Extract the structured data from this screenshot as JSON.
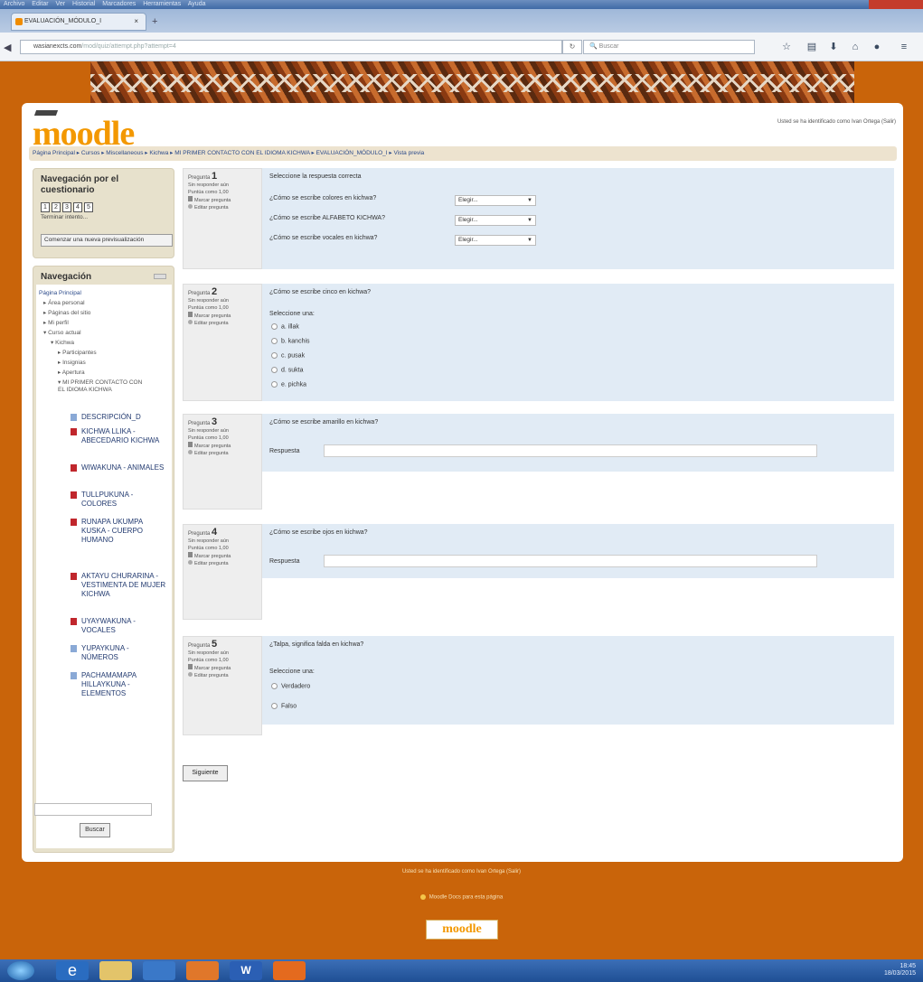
{
  "browser": {
    "menu": [
      "Archivo",
      "Editar",
      "Ver",
      "Historial",
      "Marcadores",
      "Herramientas",
      "Ayuda"
    ],
    "tab_title": "EVALUACIÓN_MÓDULO_I",
    "url_host": "wasianexcts.com",
    "url_path": "/mod/quiz/attempt.php?attempt=4",
    "search_placeholder": "Buscar"
  },
  "header": {
    "logo": "moodle",
    "logged_in": "Usted se ha identificado como Ivan Ortega (Salir)",
    "breadcrumb": "Página Principal ▸ Cursos ▸ Miscellaneous ▸ Kichwa ▸ MI PRIMER CONTACTO CON EL IDIOMA KICHWA ▸ EVALUACIÓN_MÓDULO_I ▸ Vista previa"
  },
  "quiz_nav": {
    "title": "Navegación por el cuestionario",
    "numbers": [
      "1",
      "2",
      "3",
      "4",
      "5"
    ],
    "finish": "Terminar intento...",
    "new_preview": "Comenzar una nueva previsualización"
  },
  "nav": {
    "title": "Navegación",
    "items": [
      "Página Principal",
      "Área personal",
      "Páginas del sitio",
      "Mi perfil",
      "Curso actual",
      "Kichwa",
      "Participantes",
      "Insignias",
      "Apertura",
      "MI PRIMER CONTACTO CON EL IDIOMA KICHWA"
    ],
    "resources": [
      "DESCRIPCIÓN_D",
      "KICHWA LLIKA - ABECEDARIO KICHWA",
      "WIWAKUNA - ANIMALES",
      "TULLPUKUNA - COLORES",
      "RUNAPA UKUMPA KUSKA - CUERPO HUMANO",
      "AKTAYU CHURARINA - VESTIMENTA DE MUJER KICHWA",
      "UYAYWAKUNA - VOCALES",
      "YUPAYKUNA - NÚMEROS",
      "PACHAMAMAPA HILLAYKUNA - ELEMENTOS"
    ],
    "search_button": "Buscar"
  },
  "question_meta": {
    "label": "Pregunta",
    "status": "Sin responder aún",
    "score": "Puntúa como 1,00",
    "flag": "Marcar pregunta",
    "edit": "Editar pregunta"
  },
  "q1": {
    "number": "1",
    "prompt": "Seleccione la respuesta correcta",
    "rows": [
      "¿Cómo se escribe colores en kichwa?",
      "¿Cómo se escribe ALFABETO KICHWA?",
      "¿Cómo se escribe vocales en kichwa?"
    ],
    "select_value": "Elegir..."
  },
  "q2": {
    "number": "2",
    "prompt": "¿Cómo se escribe cinco en kichwa?",
    "instr": "Seleccione una:",
    "options": [
      "a. illak",
      "b. kanchis",
      "c. pusak",
      "d. sukta",
      "e. pichka"
    ]
  },
  "q3": {
    "number": "3",
    "prompt": "¿Cómo se escribe amarillo en kichwa?",
    "answer_label": "Respuesta"
  },
  "q4": {
    "number": "4",
    "prompt": "¿Cómo se escribe ojos en kichwa?",
    "answer_label": "Respuesta"
  },
  "q5": {
    "number": "5",
    "prompt": "¿Talpa, significa falda en kichwa?",
    "instr": "Seleccione una:",
    "options": [
      "Verdadero",
      "Falso"
    ]
  },
  "next_button": "Siguiente",
  "footer": {
    "logged_in": "Usted se ha identificado como Ivan Ortega (Salir)",
    "docs": "Moodle Docs para esta página",
    "logo": "moodle"
  },
  "taskbar": {
    "time": "18:45",
    "date": "18/03/2015"
  }
}
